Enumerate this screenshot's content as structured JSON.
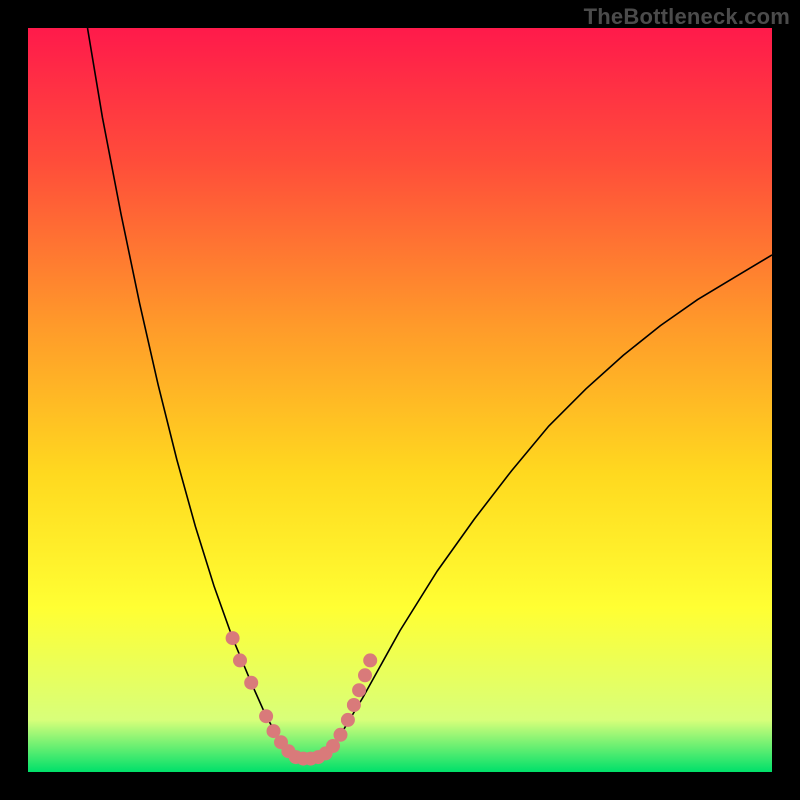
{
  "watermark": "TheBottleneck.com",
  "chart_data": {
    "type": "line",
    "title": "",
    "xlabel": "",
    "ylabel": "",
    "xlim": [
      0,
      100
    ],
    "ylim": [
      0,
      100
    ],
    "background_gradient": {
      "stops": [
        {
          "offset": 0.0,
          "color": "#ff1a4b"
        },
        {
          "offset": 0.18,
          "color": "#ff4d3a"
        },
        {
          "offset": 0.4,
          "color": "#ff9a2a"
        },
        {
          "offset": 0.6,
          "color": "#ffd91f"
        },
        {
          "offset": 0.78,
          "color": "#ffff33"
        },
        {
          "offset": 0.93,
          "color": "#d8ff7a"
        },
        {
          "offset": 1.0,
          "color": "#00e06a"
        }
      ]
    },
    "series": [
      {
        "name": "bottleneck-curve",
        "color": "#000000",
        "width": 1.6,
        "points": [
          {
            "x": 8.0,
            "y": 100.0
          },
          {
            "x": 10.0,
            "y": 88.0
          },
          {
            "x": 12.5,
            "y": 75.0
          },
          {
            "x": 15.0,
            "y": 63.0
          },
          {
            "x": 17.5,
            "y": 52.0
          },
          {
            "x": 20.0,
            "y": 42.0
          },
          {
            "x": 22.5,
            "y": 33.0
          },
          {
            "x": 25.0,
            "y": 25.0
          },
          {
            "x": 27.5,
            "y": 18.0
          },
          {
            "x": 30.0,
            "y": 12.0
          },
          {
            "x": 32.0,
            "y": 7.5
          },
          {
            "x": 34.0,
            "y": 4.0
          },
          {
            "x": 36.0,
            "y": 2.0
          },
          {
            "x": 38.0,
            "y": 1.8
          },
          {
            "x": 40.0,
            "y": 2.5
          },
          {
            "x": 42.0,
            "y": 5.0
          },
          {
            "x": 45.0,
            "y": 10.0
          },
          {
            "x": 50.0,
            "y": 19.0
          },
          {
            "x": 55.0,
            "y": 27.0
          },
          {
            "x": 60.0,
            "y": 34.0
          },
          {
            "x": 65.0,
            "y": 40.5
          },
          {
            "x": 70.0,
            "y": 46.5
          },
          {
            "x": 75.0,
            "y": 51.5
          },
          {
            "x": 80.0,
            "y": 56.0
          },
          {
            "x": 85.0,
            "y": 60.0
          },
          {
            "x": 90.0,
            "y": 63.5
          },
          {
            "x": 95.0,
            "y": 66.5
          },
          {
            "x": 100.0,
            "y": 69.5
          }
        ]
      }
    ],
    "markers": {
      "name": "highlight-dots",
      "color": "#d97a7a",
      "radius": 7,
      "points": [
        {
          "x": 27.5,
          "y": 18.0
        },
        {
          "x": 28.5,
          "y": 15.0
        },
        {
          "x": 30.0,
          "y": 12.0
        },
        {
          "x": 32.0,
          "y": 7.5
        },
        {
          "x": 33.0,
          "y": 5.5
        },
        {
          "x": 34.0,
          "y": 4.0
        },
        {
          "x": 35.0,
          "y": 2.8
        },
        {
          "x": 36.0,
          "y": 2.0
        },
        {
          "x": 37.0,
          "y": 1.8
        },
        {
          "x": 38.0,
          "y": 1.8
        },
        {
          "x": 39.0,
          "y": 2.0
        },
        {
          "x": 40.0,
          "y": 2.5
        },
        {
          "x": 41.0,
          "y": 3.5
        },
        {
          "x": 42.0,
          "y": 5.0
        },
        {
          "x": 43.0,
          "y": 7.0
        },
        {
          "x": 43.8,
          "y": 9.0
        },
        {
          "x": 44.5,
          "y": 11.0
        },
        {
          "x": 45.3,
          "y": 13.0
        },
        {
          "x": 46.0,
          "y": 15.0
        }
      ]
    }
  }
}
